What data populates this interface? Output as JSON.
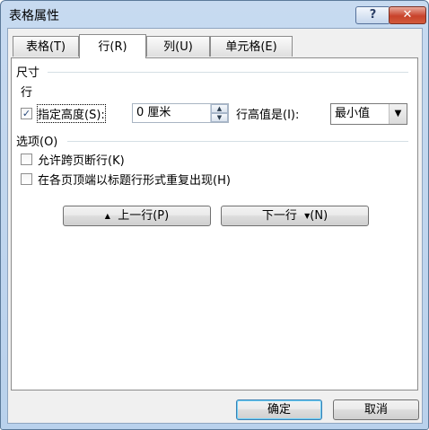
{
  "window": {
    "title": "表格属性"
  },
  "titlebar_buttons": {
    "help": "?",
    "close": "✕"
  },
  "tabs": [
    {
      "label": "表格(T)",
      "active": false
    },
    {
      "label": "行(R)",
      "active": true
    },
    {
      "label": "列(U)",
      "active": false
    },
    {
      "label": "单元格(E)",
      "active": false
    }
  ],
  "size_section": {
    "heading": "尺寸",
    "row_label": "行",
    "specify_height": {
      "label": "指定高度(S):",
      "checked": true
    },
    "height_value": "0 厘米",
    "row_height_is_label": "行高值是(I):",
    "row_height_is_value": "最小值"
  },
  "options_section": {
    "heading": "选项(O)",
    "allow_break": {
      "label": "允许跨页断行(K)",
      "checked": false
    },
    "repeat_header": {
      "label": "在各页顶端以标题行形式重复出现(H)",
      "checked": false
    }
  },
  "nav_buttons": {
    "prev_icon": "▲",
    "prev_label": "上一行(P)",
    "next_label": "下一行",
    "next_icon": "▼",
    "next_suffix": "(N)"
  },
  "footer": {
    "ok": "确定",
    "cancel": "取消"
  },
  "colors": {
    "titlebar": "#c7daf0",
    "client_bg": "#f0f0f0",
    "close_btn": "#c8422b"
  }
}
